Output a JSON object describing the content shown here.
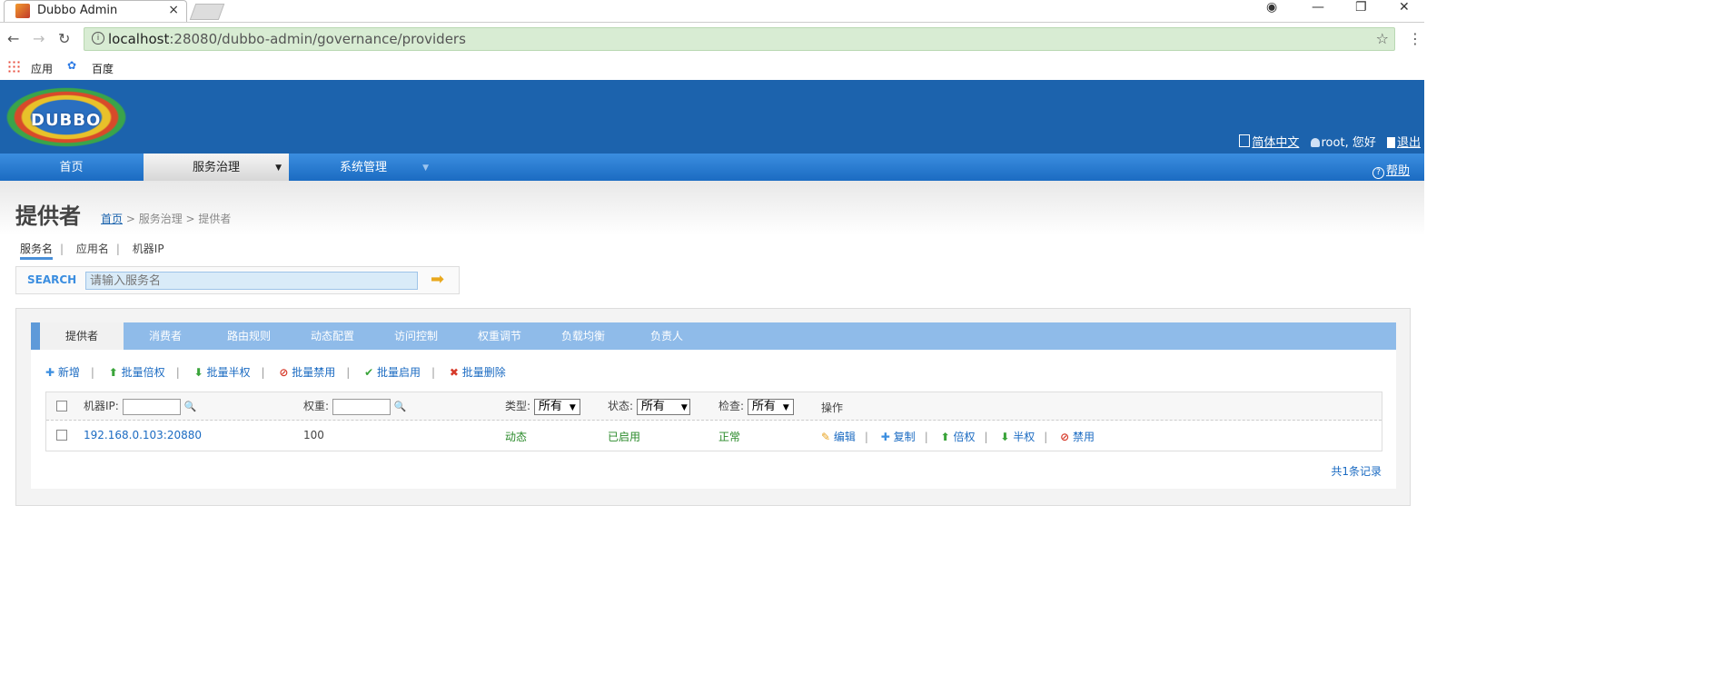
{
  "browser": {
    "tab_title": "Dubbo Admin",
    "tab_close": "×",
    "url_host": "localhost",
    "url_path": ":28080/dubbo-admin/governance/providers",
    "info_glyph": "i",
    "bookmarks": [
      "应用",
      "百度"
    ],
    "controls": {
      "account": "◉",
      "minimize": "—",
      "restore": "❐",
      "close": "✕"
    }
  },
  "header": {
    "logo_text": "DUBBO",
    "lang_link": "简体中文",
    "greeting": "root, 您好",
    "logout_link": "退出",
    "help_link": "帮助"
  },
  "mainnav": {
    "items": [
      {
        "label": "首页"
      },
      {
        "label": "服务治理",
        "arrow": "▼"
      },
      {
        "label": "系统管理",
        "arrow": "▼"
      }
    ]
  },
  "page": {
    "title": "提供者",
    "breadcrumb": {
      "home": "首页",
      "rest": " > 服务治理 > 提供者"
    },
    "search_tabs": [
      "服务名",
      "应用名",
      "机器IP"
    ],
    "search_label": "SEARCH",
    "search_placeholder": "请输入服务名",
    "search_go": "➡"
  },
  "subtabs": [
    "提供者",
    "消费者",
    "路由规则",
    "动态配置",
    "访问控制",
    "权重调节",
    "负载均衡",
    "负责人"
  ],
  "actions": [
    {
      "icon": "✚",
      "label": "新增"
    },
    {
      "icon": "⬆",
      "label": "批量倍权"
    },
    {
      "icon": "⬇",
      "label": "批量半权"
    },
    {
      "icon": "⊘",
      "label": "批量禁用"
    },
    {
      "icon": "✔",
      "label": "批量启用"
    },
    {
      "icon": "✖",
      "label": "批量删除"
    }
  ],
  "table": {
    "headers": {
      "ip": "机器IP:",
      "weight": "权重:",
      "type": "类型:",
      "status": "状态:",
      "check": "检查:",
      "ops": "操作"
    },
    "filters": {
      "type": "所有",
      "status": "所有",
      "check": "所有"
    },
    "rows": [
      {
        "ip": "192.168.0.103:20880",
        "weight": "100",
        "type": "动态",
        "status": "已启用",
        "check": "正常",
        "ops": [
          {
            "icon": "✎",
            "label": "编辑"
          },
          {
            "icon": "✚",
            "label": "复制"
          },
          {
            "icon": "⬆",
            "label": "倍权"
          },
          {
            "icon": "⬇",
            "label": "半权"
          },
          {
            "icon": "⊘",
            "label": "禁用"
          }
        ]
      }
    ],
    "total": "共1条记录"
  }
}
